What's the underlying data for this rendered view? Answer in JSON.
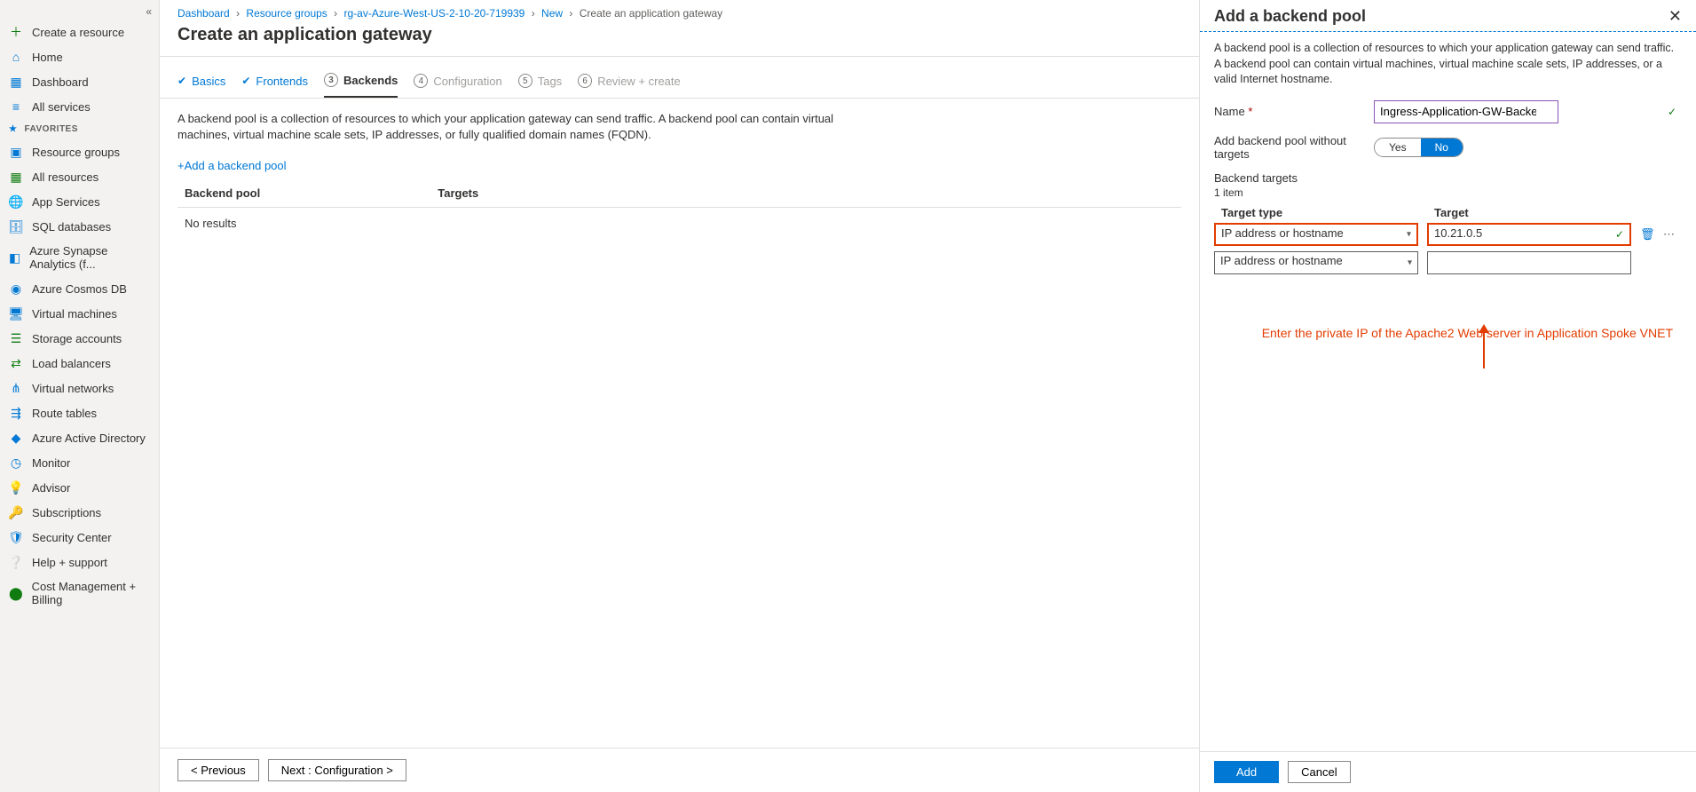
{
  "sidebar": {
    "create": "Create a resource",
    "home": "Home",
    "dashboard": "Dashboard",
    "all_services": "All services",
    "fav_header": "FAVORITES",
    "items": [
      "Resource groups",
      "All resources",
      "App Services",
      "SQL databases",
      "Azure Synapse Analytics (f...",
      "Azure Cosmos DB",
      "Virtual machines",
      "Storage accounts",
      "Load balancers",
      "Virtual networks",
      "Route tables",
      "Azure Active Directory",
      "Monitor",
      "Advisor",
      "Subscriptions",
      "Security Center",
      "Help + support",
      "Cost Management + Billing"
    ]
  },
  "breadcrumb": {
    "dashboard": "Dashboard",
    "rg": "Resource groups",
    "rg_name": "rg-av-Azure-West-US-2-10-20-719939",
    "new": "New",
    "current": "Create an application gateway"
  },
  "page_title": "Create an application gateway",
  "tabs": {
    "basics": "Basics",
    "frontends": "Frontends",
    "backends": "Backends",
    "config": "Configuration",
    "tags": "Tags",
    "review": "Review + create"
  },
  "main_desc": "A backend pool is a collection of resources to which your application gateway can send traffic. A backend pool can contain virtual machines, virtual machine scale sets, IP addresses, or fully qualified domain names (FQDN).",
  "add_pool_link": "+Add a backend pool",
  "table": {
    "col1": "Backend pool",
    "col2": "Targets",
    "empty": "No results"
  },
  "footer": {
    "prev": "< Previous",
    "next": "Next : Configuration >"
  },
  "panel": {
    "title": "Add a backend pool",
    "desc": "A backend pool is a collection of resources to which your application gateway can send traffic. A backend pool can contain virtual machines, virtual machine scale sets, IP addresses, or a valid Internet hostname.",
    "name_label": "Name",
    "name_value": "Ingress-Application-GW-Backend-Pool",
    "no_targets_label": "Add backend pool without targets",
    "yes": "Yes",
    "no": "No",
    "backend_targets": "Backend targets",
    "item_count": "1 item",
    "th_type": "Target type",
    "th_target": "Target",
    "rows": [
      {
        "type": "IP address or hostname",
        "target": "10.21.0.5"
      },
      {
        "type": "IP address or hostname",
        "target": ""
      }
    ],
    "annotation": "Enter the private IP of the Apache2 Web server in Application Spoke VNET",
    "add_btn": "Add",
    "cancel_btn": "Cancel"
  }
}
